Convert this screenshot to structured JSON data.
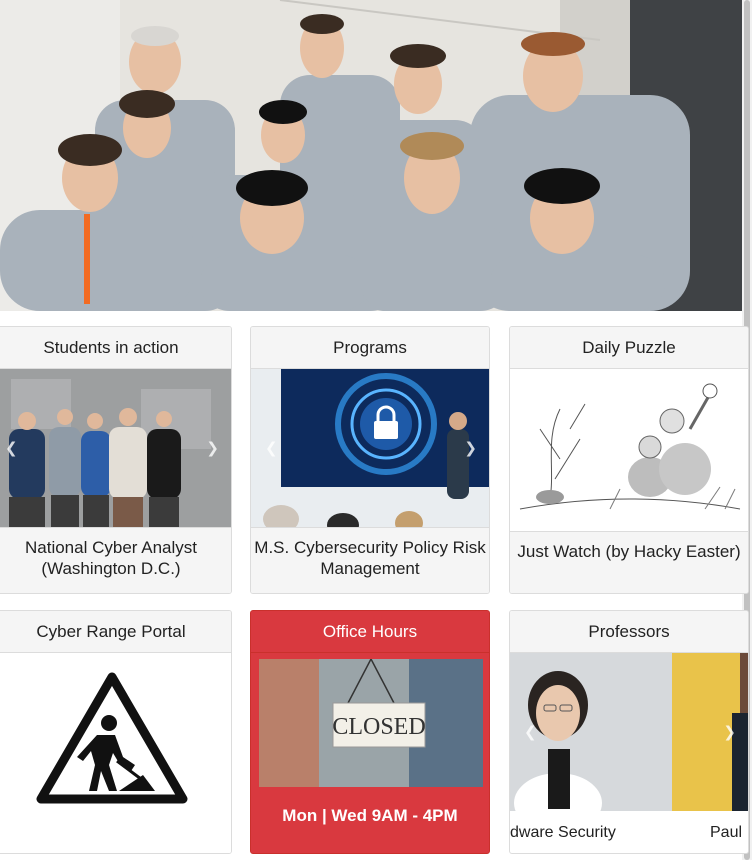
{
  "hero": {
    "description_icon": "team-photo"
  },
  "cards": [
    {
      "title": "Students in action",
      "caption": "National Cyber Analyst (Washington D.C.)"
    },
    {
      "title": "Programs",
      "caption": "M.S. Cybersecurity Policy Risk Management"
    },
    {
      "title": "Daily Puzzle",
      "caption": "Just Watch (by Hacky Easter)"
    },
    {
      "title": "Cyber Range Portal"
    },
    {
      "title": "Office Hours",
      "sign_text": "CLOSED",
      "hours": "Mon | Wed 9AM - 4PM"
    },
    {
      "title": "Professors",
      "slide_captions": [
        "dware Security",
        "Paul"
      ]
    }
  ],
  "colors": {
    "office_hours_bg": "#d9393f",
    "shirt": "#a9b2bb",
    "screen_blue": "#1e5aa8"
  },
  "icons": [
    "carousel-prev-icon",
    "carousel-next-icon",
    "lock-icon",
    "construction-sign-icon"
  ]
}
